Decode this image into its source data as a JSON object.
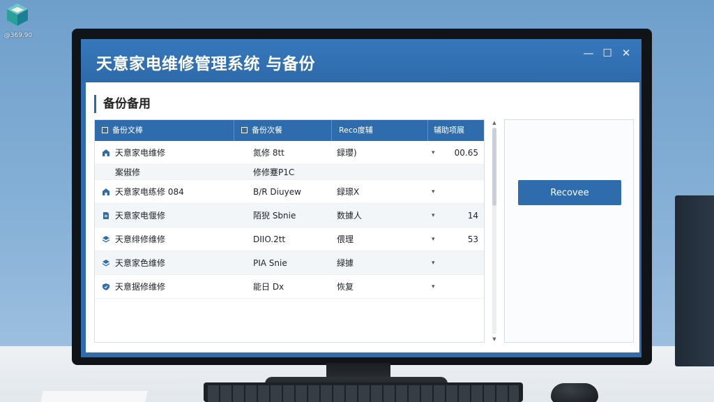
{
  "desktop": {
    "icon_name": "app-cube-icon",
    "icon_caption": "@369.90"
  },
  "window": {
    "title": "天意家电维修管理系统 与备份",
    "controls": {
      "minimize": "—",
      "maximize": "☐",
      "close": "✕"
    }
  },
  "section": {
    "title": "备份备用"
  },
  "table": {
    "headers": [
      "备份文棒",
      "备份次餐",
      "Reco度辅",
      "辅助项展"
    ],
    "rows": [
      {
        "icon": "home-icon",
        "name": "天意家电维修",
        "col2": "氮修 8tt",
        "col3": "録瓔)",
        "caret": "▾",
        "num": "00.65"
      },
      {
        "icon": "",
        "name": "案俶修",
        "col2": "修修蹇P1C",
        "col3": "",
        "caret": "",
        "num": "",
        "sub": true
      },
      {
        "icon": "home-icon",
        "name": "天意家电练修 084",
        "col2": "B/R Diuyew",
        "col3": "録璟X",
        "caret": "▾",
        "num": ""
      },
      {
        "icon": "document-icon",
        "name": "天意家电偃修",
        "col2": "陌猊 Sbnie",
        "col3": "数據人",
        "caret": "▾",
        "num": "14"
      },
      {
        "icon": "layers-icon",
        "name": "天意绯修维修",
        "col2": "DIIO.2tt",
        "col3": "偎理",
        "caret": "▾",
        "num": "53"
      },
      {
        "icon": "layers-icon",
        "name": "天意家色维修",
        "col2": "PIA Snie",
        "col3": "緑據",
        "caret": "▾",
        "num": ""
      },
      {
        "icon": "shield-icon",
        "name": "天意据修维修",
        "col2": "能日 Dx",
        "col3": "恢复",
        "caret": "▾",
        "num": ""
      }
    ]
  },
  "side_panel": {
    "button_label": "Recovee"
  },
  "colors": {
    "accent": "#2f6cae",
    "header_text": "#ffffff",
    "row_alt": "#f3f6f9"
  }
}
